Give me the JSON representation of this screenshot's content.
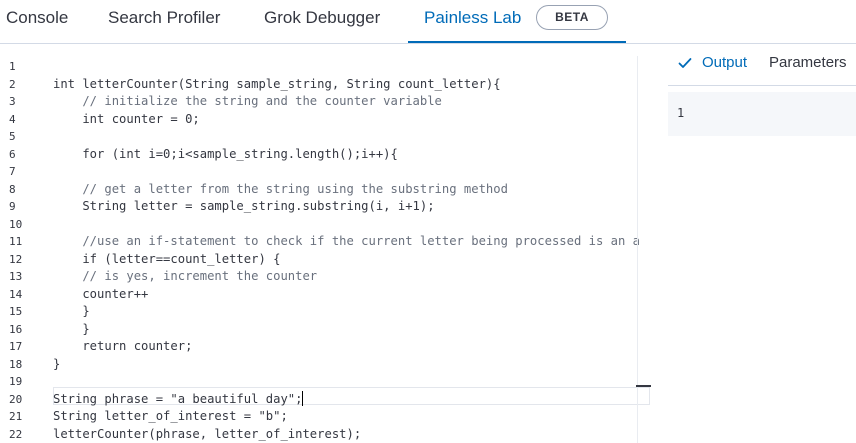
{
  "tabs": [
    {
      "label": "Console"
    },
    {
      "label": "Search Profiler"
    },
    {
      "label": "Grok Debugger"
    },
    {
      "label": "Painless Lab"
    }
  ],
  "badge": "BETA",
  "editor": {
    "line_numbers": [
      "1",
      "2",
      "3",
      "4",
      "5",
      "6",
      "7",
      "8",
      "9",
      "10",
      "11",
      "12",
      "13",
      "14",
      "15",
      "16",
      "17",
      "18",
      "19",
      "20",
      "21",
      "22"
    ],
    "lines": [
      "",
      "int letterCounter(String sample_string, String count_letter){",
      "    // initialize the string and the counter variable",
      "    int counter = 0;",
      "",
      "    for (int i=0;i<sample_string.length();i++){",
      "",
      "    // get a letter from the string using the substring method",
      "    String letter = sample_string.substring(i, i+1);",
      "",
      "    //use an if-statement to check if the current letter being processed is an a",
      "    if (letter==count_letter) {",
      "    // is yes, increment the counter",
      "    counter++",
      "    }",
      "    }",
      "    return counter;",
      "}",
      "",
      "String phrase = \"a beautiful day\";",
      "String letter_of_interest = \"b\";",
      "letterCounter(phrase, letter_of_interest);"
    ]
  },
  "output_panel": {
    "tabs": [
      {
        "label": "Output"
      },
      {
        "label": "Parameters"
      }
    ],
    "value": "1"
  },
  "colors": {
    "accent": "#006bb8",
    "text": "#343741",
    "comment": "#69707d",
    "output_bg": "#f5f7fa"
  }
}
